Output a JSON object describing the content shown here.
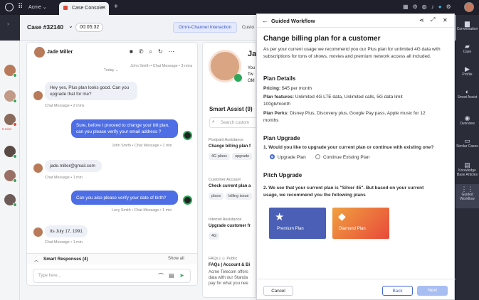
{
  "topbar": {
    "org": "Acme",
    "tab_title": "Case Console",
    "new_tab": "+"
  },
  "case": {
    "number": "Case #32140",
    "timer": "00:05:32",
    "tabs": [
      "Omni-Channel Interaction",
      "Custo"
    ]
  },
  "contacts": {
    "badge": "5 mins"
  },
  "chat": {
    "contact_name": "Jade Miller",
    "today_label": "Today",
    "messages": [
      {
        "from": "in",
        "text": "Hey yes, Plus plan looks good. Can you upgrade that for me?",
        "meta": "Chat Message • 2 mins"
      },
      {
        "from": "out",
        "text": "Sure, before I proceed to change your bill plan, can you please verify your email address ?",
        "meta": "John Smith • Chat Message • 1 min"
      },
      {
        "from": "in",
        "text": "jade.miller@gmail.com",
        "meta": "Chat Message • 1 min"
      },
      {
        "from": "out",
        "text": "Can you also please verify your date of birth?",
        "meta": "Lucy Smith • Chat Message • 1 min"
      },
      {
        "from": "in",
        "text": "Its July 17, 1991",
        "meta": "Chat Message • 1 min"
      }
    ],
    "top_meta": "John Smith • Chat Message • 3 mins",
    "smart_responses": "Smart Responses (4)",
    "show_all": "Show all",
    "placeholder": "Type here..."
  },
  "mid": {
    "name_initial": "Ja",
    "lines": [
      "You",
      "Tw",
      "OM"
    ],
    "smart_assist": "Smart Assist (9)",
    "search": "Search custom",
    "cards": [
      {
        "kicker": "Postpaid Assistance",
        "title": "Change billing plan f",
        "chips": [
          "4G plans",
          "upgrade"
        ]
      },
      {
        "kicker": "Customer Account",
        "title": "Check current plan a",
        "chips": [
          "plans",
          "billing issue"
        ]
      },
      {
        "kicker": "Internet Assistance",
        "title": "Upgrade customer fr",
        "chips": [
          "4G"
        ]
      },
      {
        "kicker": "FAQs | ☺ Public",
        "title": "FAQs | Account & Bi",
        "body": "Acme Telecom offers data with our Standa pay for what you nee"
      }
    ]
  },
  "workflow": {
    "title": "Guided Workflow",
    "heading": "Change billing plan for a customer",
    "intro": "As per your current usage we recommend you our Plus plan for unlimited 4G data with subscriptions for tons of shows, movies and premium network access all included.",
    "details_title": "Plan Details",
    "pricing_label": "Pricing:",
    "pricing_value": "$45 per month",
    "features_label": "Plan features:",
    "features_value": "Unlimited 4G LTE data, Unlimited calls, 5G data limit 100gb/month",
    "perks_label": "Plan Perks:",
    "perks_value": "Disney Plus, Discovery plus, Google Pay pass, Apple music for 12 months",
    "upgrade_title": "Plan Upgrade",
    "q1": "1.  Would you like to upgrade your current plan or continue with existing one?",
    "opt1": "Upgrade Plan",
    "opt2": "Continue Existing Plan",
    "pitch_title": "Pitch Upgrade",
    "q2": "2.  We see that your current plan is \"Silver 45\". But based on your current usage, we recommend you the following plans",
    "plan1": "Premium Plan",
    "plan2": "Diamond Plan",
    "cancel": "Cancel",
    "back": "Back",
    "next": "Next",
    "colors": {
      "premium": "#4a5fb5",
      "diamond": "#ef6a3a",
      "accent": "#4467d8"
    }
  },
  "rnav": [
    {
      "label": "Conversation",
      "icon": "chat-icon"
    },
    {
      "label": "Case",
      "icon": "case-icon"
    },
    {
      "label": "Profile",
      "icon": "profile-icon"
    },
    {
      "label": "Smart Assist",
      "icon": "smart-assist-icon"
    },
    {
      "label": "Overview",
      "icon": "eye-icon"
    },
    {
      "label": "Similar Cases",
      "icon": "similar-cases-icon"
    },
    {
      "label": "Knowledge Base Articles",
      "icon": "book-icon"
    },
    {
      "label": "Guided Workflow",
      "icon": "workflow-icon"
    }
  ]
}
